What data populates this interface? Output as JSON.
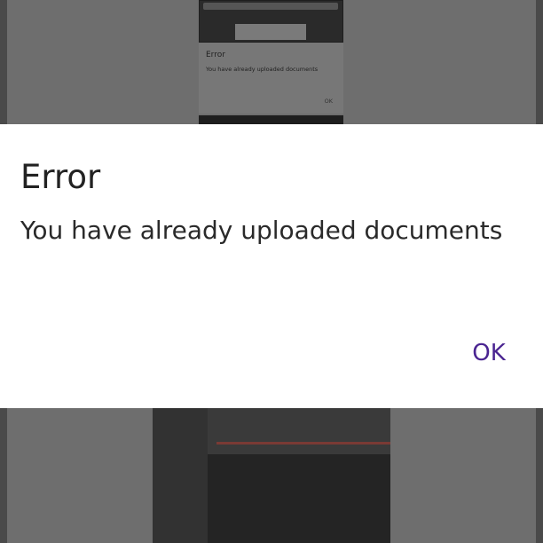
{
  "background": {
    "thumbnail_dialog": {
      "title": "Error",
      "message": "You have already uploaded documents",
      "ok_label": "OK"
    }
  },
  "dialog": {
    "title": "Error",
    "message": "You have already uploaded documents",
    "ok_label": "OK"
  },
  "colors": {
    "accent": "#4a2491",
    "scrim": "#6e6e6e",
    "dialog_background": "#ffffff"
  }
}
